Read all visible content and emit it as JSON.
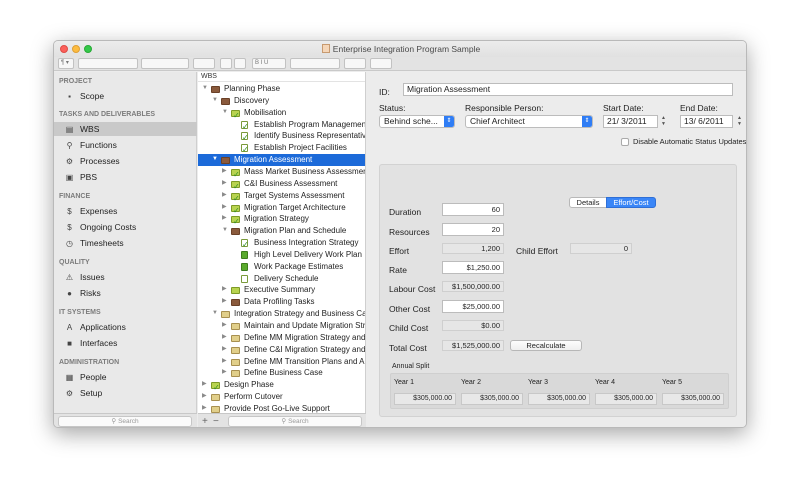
{
  "window": {
    "title": "Enterprise Integration Program Sample"
  },
  "sidebar": {
    "sections": [
      {
        "heading": "PROJECT",
        "items": [
          {
            "label": "Scope",
            "icon": "scope-icon"
          }
        ]
      },
      {
        "heading": "TASKS AND DELIVERABLES",
        "items": [
          {
            "label": "WBS",
            "icon": "wbs-icon",
            "selected": true
          },
          {
            "label": "Functions",
            "icon": "functions-icon"
          },
          {
            "label": "Processes",
            "icon": "processes-icon"
          },
          {
            "label": "PBS",
            "icon": "pbs-icon"
          }
        ]
      },
      {
        "heading": "FINANCE",
        "items": [
          {
            "label": "Expenses",
            "icon": "expenses-icon"
          },
          {
            "label": "Ongoing Costs",
            "icon": "ongoing-costs-icon"
          },
          {
            "label": "Timesheets",
            "icon": "timesheets-icon"
          }
        ]
      },
      {
        "heading": "QUALITY",
        "items": [
          {
            "label": "Issues",
            "icon": "warning-icon"
          },
          {
            "label": "Risks",
            "icon": "risks-icon"
          }
        ]
      },
      {
        "heading": "IT SYSTEMS",
        "items": [
          {
            "label": "Applications",
            "icon": "applications-icon"
          },
          {
            "label": "Interfaces",
            "icon": "interfaces-icon"
          }
        ]
      },
      {
        "heading": "ADMINISTRATION",
        "items": [
          {
            "label": "People",
            "icon": "people-icon"
          },
          {
            "label": "Setup",
            "icon": "gear-icon"
          }
        ]
      }
    ],
    "search_placeholder": "Search"
  },
  "tree": {
    "header": "WBS",
    "search_placeholder": "Search",
    "add": "+",
    "remove": "−",
    "rows": [
      {
        "label": "Planning Phase",
        "level": 0,
        "arrow": "▼",
        "icon": "folder-brown"
      },
      {
        "label": "Discovery",
        "level": 1,
        "arrow": "▼",
        "icon": "folder-brown"
      },
      {
        "label": "Mobilisation",
        "level": 2,
        "arrow": "▼",
        "icon": "folder-check"
      },
      {
        "label": "Establish Program Management",
        "level": 3,
        "arrow": "",
        "icon": "task-check"
      },
      {
        "label": "Identify Business Representatives",
        "level": 3,
        "arrow": "",
        "icon": "task-check"
      },
      {
        "label": "Establish Project Facilities",
        "level": 3,
        "arrow": "",
        "icon": "task-check"
      },
      {
        "label": "Migration Assessment",
        "level": 1,
        "arrow": "▼",
        "icon": "folder-brown",
        "selected": true
      },
      {
        "label": "Mass Market Business Assessment",
        "level": 2,
        "arrow": "▶",
        "icon": "folder-check"
      },
      {
        "label": "C&I Business Assessment",
        "level": 2,
        "arrow": "▶",
        "icon": "folder-check"
      },
      {
        "label": "Target Systems Assessment",
        "level": 2,
        "arrow": "▶",
        "icon": "folder-check"
      },
      {
        "label": "Migration Target Architecture",
        "level": 2,
        "arrow": "▶",
        "icon": "folder-check"
      },
      {
        "label": "Migration Strategy",
        "level": 2,
        "arrow": "▶",
        "icon": "folder-check"
      },
      {
        "label": "Migration Plan and Schedule",
        "level": 2,
        "arrow": "▼",
        "icon": "folder-brown"
      },
      {
        "label": "Business Integration Strategy",
        "level": 3,
        "arrow": "",
        "icon": "task-check"
      },
      {
        "label": "High Level Delivery Work Plan",
        "level": 3,
        "arrow": "",
        "icon": "task-green"
      },
      {
        "label": "Work Package Estimates",
        "level": 3,
        "arrow": "",
        "icon": "task-green"
      },
      {
        "label": "Delivery Schedule",
        "level": 3,
        "arrow": "",
        "icon": "task-plain"
      },
      {
        "label": "Executive Summary",
        "level": 2,
        "arrow": "▶",
        "icon": "folder-green"
      },
      {
        "label": "Data Profiling Tasks",
        "level": 2,
        "arrow": "▶",
        "icon": "folder-brown"
      },
      {
        "label": "Integration Strategy and Business Case",
        "level": 1,
        "arrow": "▼",
        "icon": "folder-yellow"
      },
      {
        "label": "Maintain and Update Migration Strategy",
        "level": 2,
        "arrow": "▶",
        "icon": "folder-yellow"
      },
      {
        "label": "Define MM Migration Strategy and Plan",
        "level": 2,
        "arrow": "▶",
        "icon": "folder-yellow"
      },
      {
        "label": "Define C&I Migration Strategy and Plan",
        "level": 2,
        "arrow": "▶",
        "icon": "folder-yellow"
      },
      {
        "label": "Define MM Transition Plans and Approach",
        "level": 2,
        "arrow": "▶",
        "icon": "folder-yellow"
      },
      {
        "label": "Define Business Case",
        "level": 2,
        "arrow": "▶",
        "icon": "folder-yellow"
      },
      {
        "label": "Design Phase",
        "level": 0,
        "arrow": "▶",
        "icon": "folder-check"
      },
      {
        "label": "Perform Cutover",
        "level": 0,
        "arrow": "▶",
        "icon": "folder-yellow"
      },
      {
        "label": "Provide Post Go-Live Support",
        "level": 0,
        "arrow": "▶",
        "icon": "folder-yellow"
      }
    ]
  },
  "detail": {
    "id_label": "ID:",
    "id_value": "Migration Assessment",
    "status_label": "Status:",
    "status_value": "Behind sche...",
    "person_label": "Responsible Person:",
    "person_value": "Chief Architect",
    "start_label": "Start Date:",
    "start_value": "21/ 3/2011",
    "end_label": "End Date:",
    "end_value": "13/ 6/2011",
    "auto_status_label": "Disable Automatic Status Updates",
    "tabs": [
      "Details",
      "Effort/Cost"
    ],
    "active_tab": "Effort/Cost",
    "duration_label": "Duration",
    "duration_value": "60",
    "resources_label": "Resources",
    "resources_value": "20",
    "effort_label": "Effort",
    "effort_value": "1,200",
    "child_effort_label": "Child Effort",
    "child_effort_value": "0",
    "rate_label": "Rate",
    "rate_value": "$1,250.00",
    "labour_cost_label": "Labour Cost",
    "labour_cost_value": "$1,500,000.00",
    "other_cost_label": "Other Cost",
    "other_cost_value": "$25,000.00",
    "child_cost_label": "Child Cost",
    "child_cost_value": "$0.00",
    "total_cost_label": "Total Cost",
    "total_cost_value": "$1,525,000.00",
    "recalculate_label": "Recalculate",
    "annual_split_label": "Annual Split",
    "years": [
      {
        "label": "Year 1",
        "value": "$305,000.00"
      },
      {
        "label": "Year 2",
        "value": "$305,000.00"
      },
      {
        "label": "Year 3",
        "value": "$305,000.00"
      },
      {
        "label": "Year 4",
        "value": "$305,000.00"
      },
      {
        "label": "Year 5",
        "value": "$305,000.00"
      }
    ]
  }
}
